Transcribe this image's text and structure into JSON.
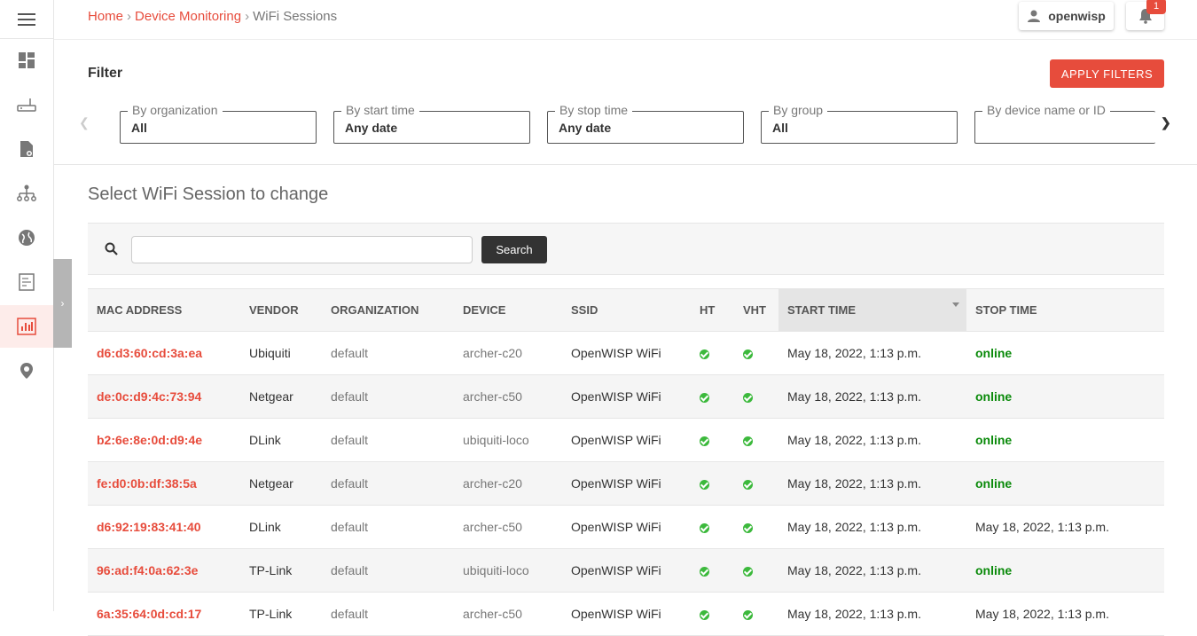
{
  "breadcrumb": {
    "home": "Home",
    "section": "Device Monitoring",
    "current": "WiFi Sessions",
    "separator": "›"
  },
  "user": {
    "name": "openwisp"
  },
  "notifications": {
    "count": "1"
  },
  "filter": {
    "title": "Filter",
    "apply_label": "APPLY FILTERS",
    "boxes": [
      {
        "label": "By organization",
        "value": "All"
      },
      {
        "label": "By start time",
        "value": "Any date"
      },
      {
        "label": "By stop time",
        "value": "Any date"
      },
      {
        "label": "By group",
        "value": "All"
      },
      {
        "label": "By device name or ID",
        "value": ""
      }
    ]
  },
  "content": {
    "title": "Select WiFi Session to change"
  },
  "search": {
    "button_label": "Search",
    "value": ""
  },
  "table": {
    "headers": [
      "MAC ADDRESS",
      "VENDOR",
      "ORGANIZATION",
      "DEVICE",
      "SSID",
      "HT",
      "VHT",
      "START TIME",
      "STOP TIME"
    ],
    "rows": [
      {
        "mac": "d6:d3:60:cd:3a:ea",
        "vendor": "Ubiquiti",
        "org": "default",
        "device": "archer-c20",
        "ssid": "OpenWISP WiFi",
        "start": "May 18, 2022, 1:13 p.m.",
        "stop": "online"
      },
      {
        "mac": "de:0c:d9:4c:73:94",
        "vendor": "Netgear",
        "org": "default",
        "device": "archer-c50",
        "ssid": "OpenWISP WiFi",
        "start": "May 18, 2022, 1:13 p.m.",
        "stop": "online"
      },
      {
        "mac": "b2:6e:8e:0d:d9:4e",
        "vendor": "DLink",
        "org": "default",
        "device": "ubiquiti-loco",
        "ssid": "OpenWISP WiFi",
        "start": "May 18, 2022, 1:13 p.m.",
        "stop": "online"
      },
      {
        "mac": "fe:d0:0b:df:38:5a",
        "vendor": "Netgear",
        "org": "default",
        "device": "archer-c20",
        "ssid": "OpenWISP WiFi",
        "start": "May 18, 2022, 1:13 p.m.",
        "stop": "online"
      },
      {
        "mac": "d6:92:19:83:41:40",
        "vendor": "DLink",
        "org": "default",
        "device": "archer-c50",
        "ssid": "OpenWISP WiFi",
        "start": "May 18, 2022, 1:13 p.m.",
        "stop": "May 18, 2022, 1:13 p.m."
      },
      {
        "mac": "96:ad:f4:0a:62:3e",
        "vendor": "TP-Link",
        "org": "default",
        "device": "ubiquiti-loco",
        "ssid": "OpenWISP WiFi",
        "start": "May 18, 2022, 1:13 p.m.",
        "stop": "online"
      },
      {
        "mac": "6a:35:64:0d:cd:17",
        "vendor": "TP-Link",
        "org": "default",
        "device": "archer-c50",
        "ssid": "OpenWISP WiFi",
        "start": "May 18, 2022, 1:13 p.m.",
        "stop": "May 18, 2022, 1:13 p.m."
      }
    ]
  },
  "colors": {
    "accent": "#e74c3c",
    "online": "#0a8a0a",
    "check": "#3cb93c",
    "dark_button": "#333333"
  },
  "icons": {
    "sidebar": [
      "menu-icon",
      "dashboard-icon",
      "router-icon",
      "file-settings-icon",
      "network-topology-icon",
      "globe-icon",
      "floorplan-icon",
      "monitoring-chart-icon",
      "location-pin-icon"
    ]
  }
}
